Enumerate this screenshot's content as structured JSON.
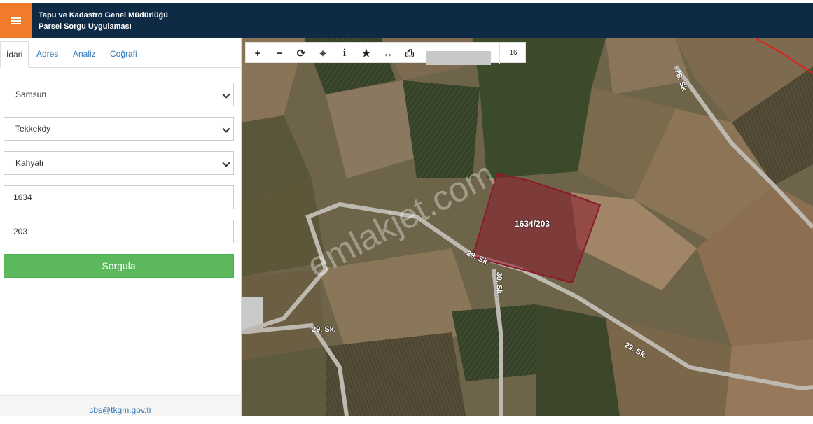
{
  "header": {
    "title_line1": "Tapu ve Kadastro Genel Müdürlüğü",
    "title_line2": "Parsel Sorgu Uygulaması",
    "menu_icon": "hamburger-icon",
    "accent_color": "#f07b2b",
    "bar_color": "#0e2a44"
  },
  "tabs": [
    {
      "label": "İdari",
      "active": true
    },
    {
      "label": "Adres",
      "active": false
    },
    {
      "label": "Analiz",
      "active": false
    },
    {
      "label": "Coğrafi",
      "active": false
    }
  ],
  "form": {
    "province": "Samsun",
    "district": "Tekkeköy",
    "neighborhood": "Kahyalı",
    "block": "1634",
    "parcel": "203",
    "submit_label": "Sorgula"
  },
  "footer": {
    "email": "cbs@tkgm.gov.tr"
  },
  "toolbar": {
    "tools": [
      "zoom-in-icon",
      "zoom-out-icon",
      "refresh-icon",
      "locate-icon",
      "info-icon",
      "star-icon",
      "measure-icon",
      "print-icon"
    ],
    "symbols": [
      "+",
      "−",
      "⟳",
      "⌖",
      "i",
      "★",
      "↔",
      "⎙"
    ],
    "zoom_level": "16"
  },
  "map": {
    "parcel_label": "1634/203",
    "parcel_color": "#8b1a2b",
    "roads": [
      "29. Sk.",
      "30. Sk.",
      "29. Sk.",
      "29. Sk.",
      "28. Sk."
    ],
    "watermark": "emlakjet.com"
  }
}
